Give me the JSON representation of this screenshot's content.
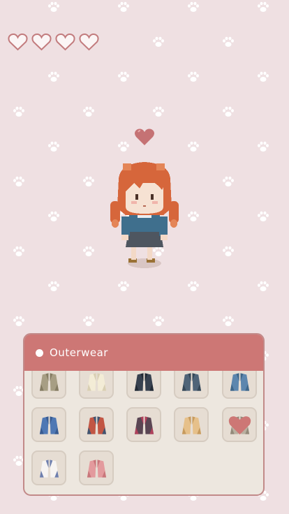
{
  "game": {
    "hearts": [
      {
        "icon": "heart-outline-icon",
        "filled": false
      },
      {
        "icon": "heart-outline-icon",
        "filled": false
      },
      {
        "icon": "heart-outline-icon",
        "filled": false
      },
      {
        "icon": "heart-outline-icon",
        "filled": false
      }
    ],
    "affection_icon": "heart-filled-icon",
    "character": "pixel-girl-orange-braids"
  },
  "wardrobe": {
    "title": "Outerwear",
    "items": [
      {
        "name": "khaki-jacket",
        "color": "#a79e84",
        "dark": "#857c63",
        "favorite": false
      },
      {
        "name": "cream-jacket",
        "color": "#f3ecd6",
        "dark": "#d9cfb3",
        "favorite": false
      },
      {
        "name": "navy-coat",
        "color": "#37414f",
        "dark": "#222a35",
        "favorite": false
      },
      {
        "name": "slate-blue-jacket",
        "color": "#4f6478",
        "dark": "#354757",
        "favorite": false
      },
      {
        "name": "denim-jacket",
        "color": "#5c86ae",
        "dark": "#3e6689",
        "favorite": false
      },
      {
        "name": "blue-cape",
        "color": "#4f78b4",
        "dark": "#385b91",
        "favorite": false
      },
      {
        "name": "plaid-jacket",
        "color": "#c25644",
        "dark": "#3f5572",
        "favorite": false
      },
      {
        "name": "burgundy-coat",
        "color": "#5a4553",
        "dark": "#b0415b",
        "favorite": false
      },
      {
        "name": "camel-jacket",
        "color": "#e6c08a",
        "dark": "#c79b5e",
        "favorite": false
      },
      {
        "name": "grey-trench",
        "color": "#b9b0a0",
        "dark": "#938a7a",
        "favorite": true
      },
      {
        "name": "white-cape",
        "color": "#f7f4f2",
        "dark": "#6e7fae",
        "favorite": false
      },
      {
        "name": "pink-cape",
        "color": "#e39a9d",
        "dark": "#c8767a",
        "favorite": false
      }
    ]
  },
  "colors": {
    "background": "#efe0e2",
    "paw": "#ffffff",
    "heart_outline": "#c27b7d",
    "accent": "#cd7775",
    "panel": "#ede7df"
  }
}
